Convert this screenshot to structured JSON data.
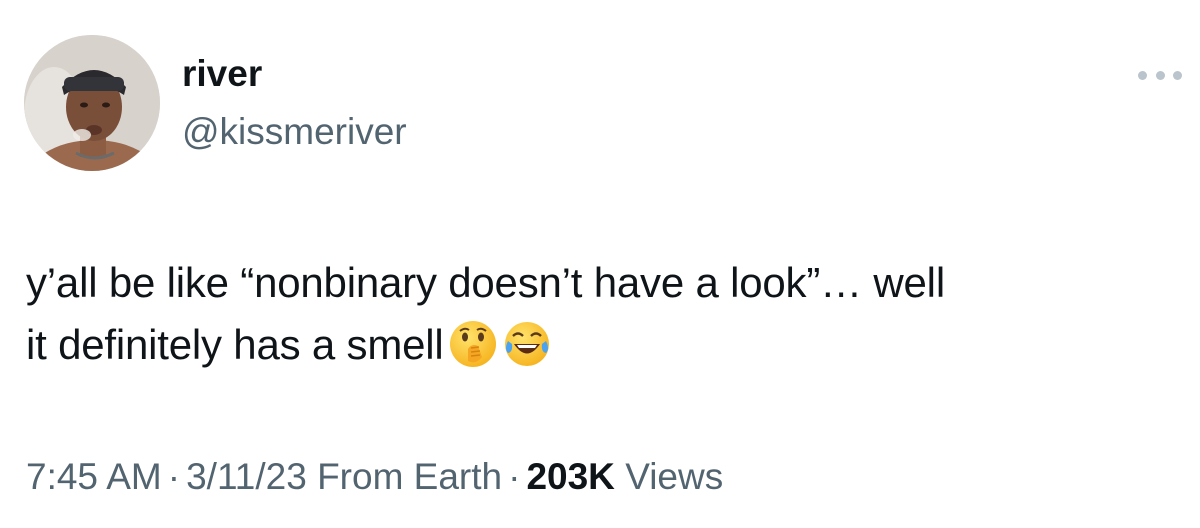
{
  "author": {
    "display_name": "river",
    "handle": "@kissmeriver"
  },
  "tweet": {
    "line1": "y’all be like “nonbinary doesn’t have a look”… well",
    "line2": "it definitely has a smell",
    "emojis": [
      "face-with-hand-over-mouth-emoji",
      "tears-of-joy-emoji"
    ]
  },
  "meta": {
    "time": "7:45 AM",
    "separator": "·",
    "date": "3/11/23",
    "source": "From Earth",
    "views_count": "203K",
    "views_label": "Views"
  },
  "icons": {
    "more": "more-horizontal-icon"
  },
  "colors": {
    "text_primary": "#0f1419",
    "text_secondary": "#536471",
    "more_dots": "#b9c4cc",
    "background": "#ffffff"
  }
}
